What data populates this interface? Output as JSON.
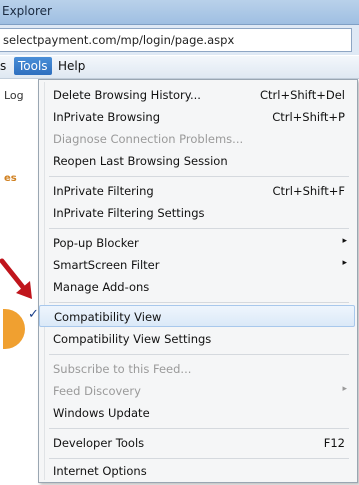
{
  "window": {
    "title": "Explorer"
  },
  "address": {
    "url": "selectpayment.com/mp/login/page.aspx"
  },
  "menubar": {
    "items": [
      {
        "label": "s"
      },
      {
        "label": "Tools"
      },
      {
        "label": "Help"
      }
    ]
  },
  "page": {
    "fragment_left": "Log",
    "fragment_logo": "es"
  },
  "tools_menu": {
    "items": [
      {
        "label": "Delete Browsing History...",
        "shortcut": "Ctrl+Shift+Del"
      },
      {
        "label": "InPrivate Browsing",
        "shortcut": "Ctrl+Shift+P"
      },
      {
        "label": "Diagnose Connection Problems..."
      },
      {
        "label": "Reopen Last Browsing Session"
      },
      {
        "label": "InPrivate Filtering",
        "shortcut": "Ctrl+Shift+F"
      },
      {
        "label": "InPrivate Filtering Settings"
      },
      {
        "label": "Pop-up Blocker"
      },
      {
        "label": "SmartScreen Filter"
      },
      {
        "label": "Manage Add-ons"
      },
      {
        "label": "Compatibility View",
        "checked": true
      },
      {
        "label": "Compatibility View Settings"
      },
      {
        "label": "Subscribe to this Feed..."
      },
      {
        "label": "Feed Discovery"
      },
      {
        "label": "Windows Update"
      },
      {
        "label": "Developer Tools",
        "shortcut": "F12"
      },
      {
        "label": "Internet Options"
      }
    ],
    "check_glyph": "✓",
    "submenu_glyph": "▸"
  },
  "colors": {
    "menu_highlight": "#dbe9f8",
    "active_menu": "#2e6fbf",
    "arrow": "#c0151c"
  }
}
